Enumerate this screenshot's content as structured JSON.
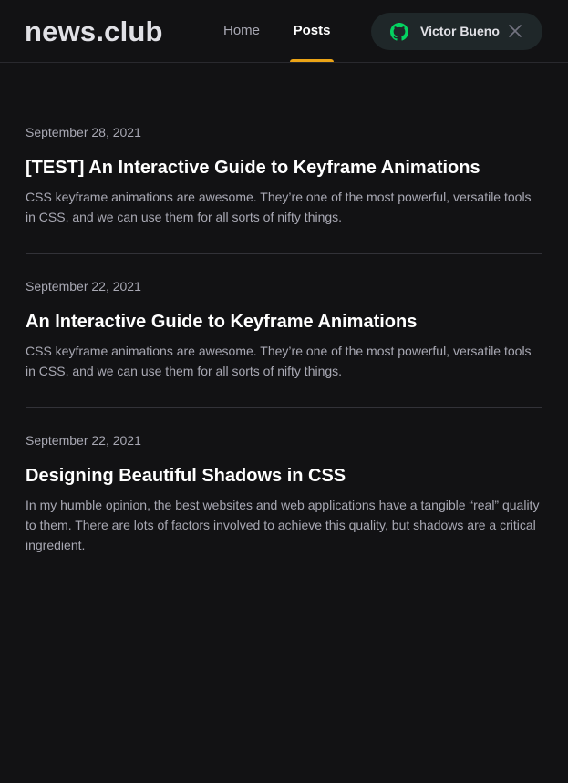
{
  "header": {
    "logo": "news.club",
    "nav": [
      {
        "label": "Home",
        "active": false
      },
      {
        "label": "Posts",
        "active": true
      }
    ],
    "user": {
      "name": "Victor Bueno",
      "icon": "github-icon",
      "icon_color": "#04d361",
      "close_icon": "close-icon"
    },
    "accent_color": "#eba417"
  },
  "posts": [
    {
      "date": "September 28, 2021",
      "title": "[TEST] An Interactive Guide to Keyframe Animations",
      "excerpt": "CSS keyframe animations are awesome. They’re one of the most powerful, versatile tools in CSS, and we can use them for all sorts of nifty things."
    },
    {
      "date": "September 22, 2021",
      "title": "An Interactive Guide to Keyframe Animations",
      "excerpt": "CSS keyframe animations are awesome. They’re one of the most powerful, versatile tools in CSS, and we can use them for all sorts of nifty things."
    },
    {
      "date": "September 22, 2021",
      "title": "Designing Beautiful Shadows in CSS",
      "excerpt": "In my humble opinion, the best websites and web applications have a tangible “real” quality to them. There are lots of factors involved to achieve this quality, but shadows are a critical ingredient."
    }
  ]
}
